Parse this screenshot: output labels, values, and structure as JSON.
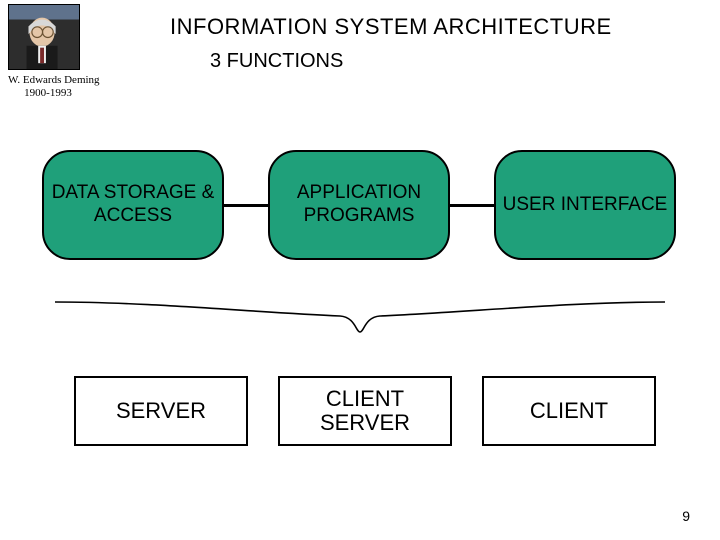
{
  "title": "INFORMATION SYSTEM ARCHITECTURE",
  "subtitle": "3 FUNCTIONS",
  "portrait": {
    "name": "W. Edwards Deming",
    "years": "1900-1993"
  },
  "functions": [
    {
      "label": "DATA STORAGE & ACCESS"
    },
    {
      "label": "APPLICATION PROGRAMS"
    },
    {
      "label": "USER INTERFACE"
    }
  ],
  "tiers": [
    {
      "label": "SERVER"
    },
    {
      "label": "CLIENT SERVER"
    },
    {
      "label": "CLIENT"
    }
  ],
  "page_number": "9"
}
